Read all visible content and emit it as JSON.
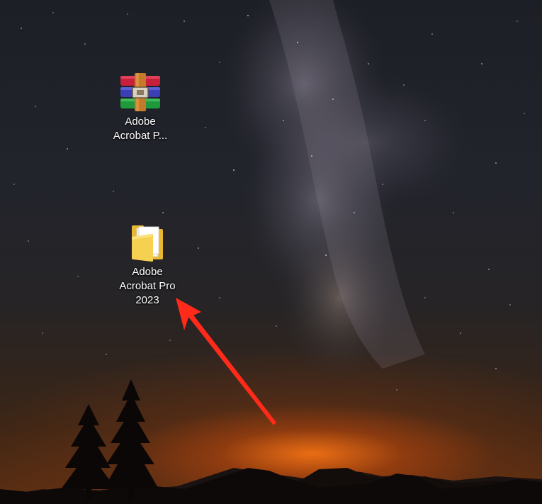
{
  "desktop": {
    "icons": [
      {
        "name": "archive",
        "label": "Adobe\nAcrobat P...",
        "icon": "winrar-archive-icon"
      },
      {
        "name": "folder",
        "label": "Adobe\nAcrobat Pro\n2023",
        "icon": "folder-icon"
      }
    ]
  },
  "annotation": {
    "type": "arrow",
    "color": "#ff2a1a",
    "points_to": "folder"
  }
}
